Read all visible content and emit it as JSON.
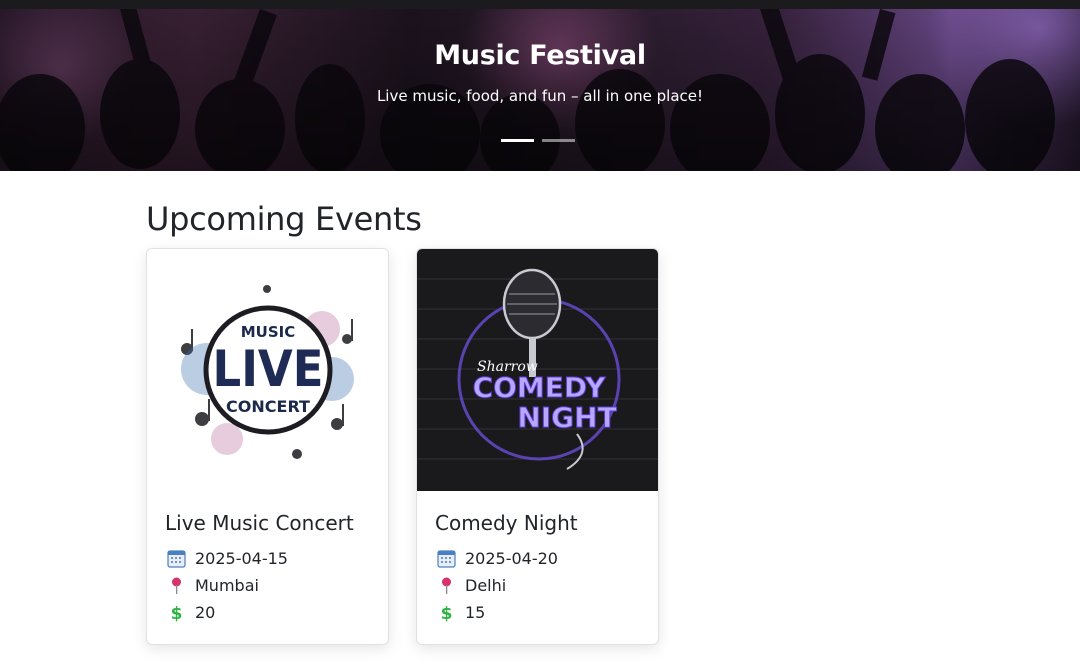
{
  "hero": {
    "title": "Music Festival",
    "subtitle": "Live music, food, and fun – all in one place!",
    "slides": 2,
    "active_slide": 1
  },
  "section": {
    "title": "Upcoming Events"
  },
  "events": [
    {
      "title": "Live Music Concert",
      "date": "2025-04-15",
      "location": "Mumbai",
      "price": "20",
      "image_text": {
        "top": "MUSIC",
        "main": "LIVE",
        "bottom": "CONCERT"
      }
    },
    {
      "title": "Comedy Night",
      "date": "2025-04-20",
      "location": "Delhi",
      "price": "15",
      "image_text": {
        "brand": "Sharrow",
        "line1": "COMEDY",
        "line2": "NIGHT"
      }
    }
  ],
  "icons": {
    "date": "calendar-icon",
    "location": "pushpin-icon",
    "price": "dollar-icon"
  },
  "colors": {
    "text": "#212529",
    "location_pin": "#d6336c",
    "price": "#2fb344",
    "calendar": "#4a7fc1"
  }
}
